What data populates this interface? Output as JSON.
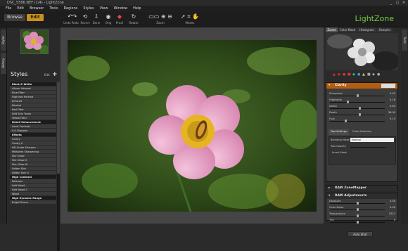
{
  "window": {
    "title": "DSC_5586.NEF (1/4) - LightZone",
    "min": "_",
    "max": "□",
    "close": "✕"
  },
  "menu": [
    "File",
    "Edit",
    "Browser",
    "Tools",
    "Regions",
    "Styles",
    "View",
    "Window",
    "Help"
  ],
  "toolbar": {
    "browse": "Browse",
    "edit": "Edit",
    "undo_redo": "Undo Redo",
    "revert": "Revert",
    "done": "Done",
    "orig": "Orig",
    "proof": "Proof",
    "rotate": "Rotate",
    "zoom": "Zoom",
    "fit": "1:1",
    "modes": "Modes"
  },
  "logo": "LightZone",
  "sidetabs": {
    "left_top": "Styles",
    "left_mid": "History",
    "right_top": "Tools"
  },
  "styles": {
    "title": "Styles",
    "edit_label": "Edit",
    "add": "+",
    "items": [
      {
        "label": "Black & White",
        "category": true
      },
      {
        "label": "Album Infrared",
        "category": false
      },
      {
        "label": "Blue Filter",
        "category": false
      },
      {
        "label": "High Key Portrait",
        "category": false
      },
      {
        "label": "Infrared",
        "category": false
      },
      {
        "label": "Neutral",
        "category": false
      },
      {
        "label": "Red Filter",
        "category": false
      },
      {
        "label": "Soft Skin Tones",
        "category": false
      },
      {
        "label": "Yellow Filter",
        "category": false
      },
      {
        "label": "Detail Enhancement",
        "category": true
      },
      {
        "label": "Local Contrast",
        "category": false
      },
      {
        "label": "S.O.Sharpen",
        "category": false
      },
      {
        "label": "Effects",
        "category": true
      },
      {
        "label": "Clarity",
        "category": false
      },
      {
        "label": "Clarity II",
        "category": false
      },
      {
        "label": "HD Under Sharpen",
        "category": false
      },
      {
        "label": "Midtones Sharpening",
        "category": false
      },
      {
        "label": "Skin Glow",
        "category": false
      },
      {
        "label": "Skin Glow II",
        "category": false
      },
      {
        "label": "Skin Glow III",
        "category": false
      },
      {
        "label": "Soften Skin",
        "category": false
      },
      {
        "label": "Soften Skin II",
        "category": false
      },
      {
        "label": "High Contrast",
        "category": true
      },
      {
        "label": "Polarizer",
        "category": false
      },
      {
        "label": "Soft Wood",
        "category": false
      },
      {
        "label": "Soft Wood 2",
        "category": false
      },
      {
        "label": "Wood",
        "category": false
      },
      {
        "label": "High Dynamic Range",
        "category": true
      },
      {
        "label": "Bright Scene",
        "category": false
      }
    ]
  },
  "right_tabs": [
    "Zones",
    "Color Mask",
    "Histogram",
    "Sampler"
  ],
  "clarity": {
    "title": "Clarity",
    "sliders": [
      {
        "name": "Sharpness",
        "value": "0.90",
        "pos": 0.5
      },
      {
        "name": "Highlights",
        "value": "0.18",
        "pos": 0.32
      },
      {
        "name": "Detail",
        "value": "0.64",
        "pos": 0.55
      },
      {
        "name": "Depth",
        "value": "36.00",
        "pos": 0.55
      },
      {
        "name": "Fuzz",
        "value": "0.15",
        "pos": 0.28
      }
    ],
    "subtabs": {
      "tool": "Tool Settings",
      "color": "Color Selection"
    },
    "blending_label": "Blending Mode",
    "blending_value": "Normal",
    "opacity_label": "Tool Opacity",
    "invert_label": "Invert Mask"
  },
  "zone_mapper": {
    "title": "RAW ZoneMapper"
  },
  "raw_adj": {
    "title": "RAW Adjustments",
    "sliders": [
      {
        "name": "Exposure",
        "value": "0.00",
        "pos": 0.5
      },
      {
        "name": "Color Noise",
        "value": "0.00",
        "pos": 0.5
      },
      {
        "name": "Temperature",
        "value": "5221",
        "pos": 0.5
      },
      {
        "name": "Tint",
        "value": "0",
        "pos": 0.5
      }
    ],
    "autoshot": "Auto Shot"
  },
  "colors": {
    "accent": "#b35d10",
    "logo": "#7cc94a",
    "panel": "#3c3c3c"
  }
}
